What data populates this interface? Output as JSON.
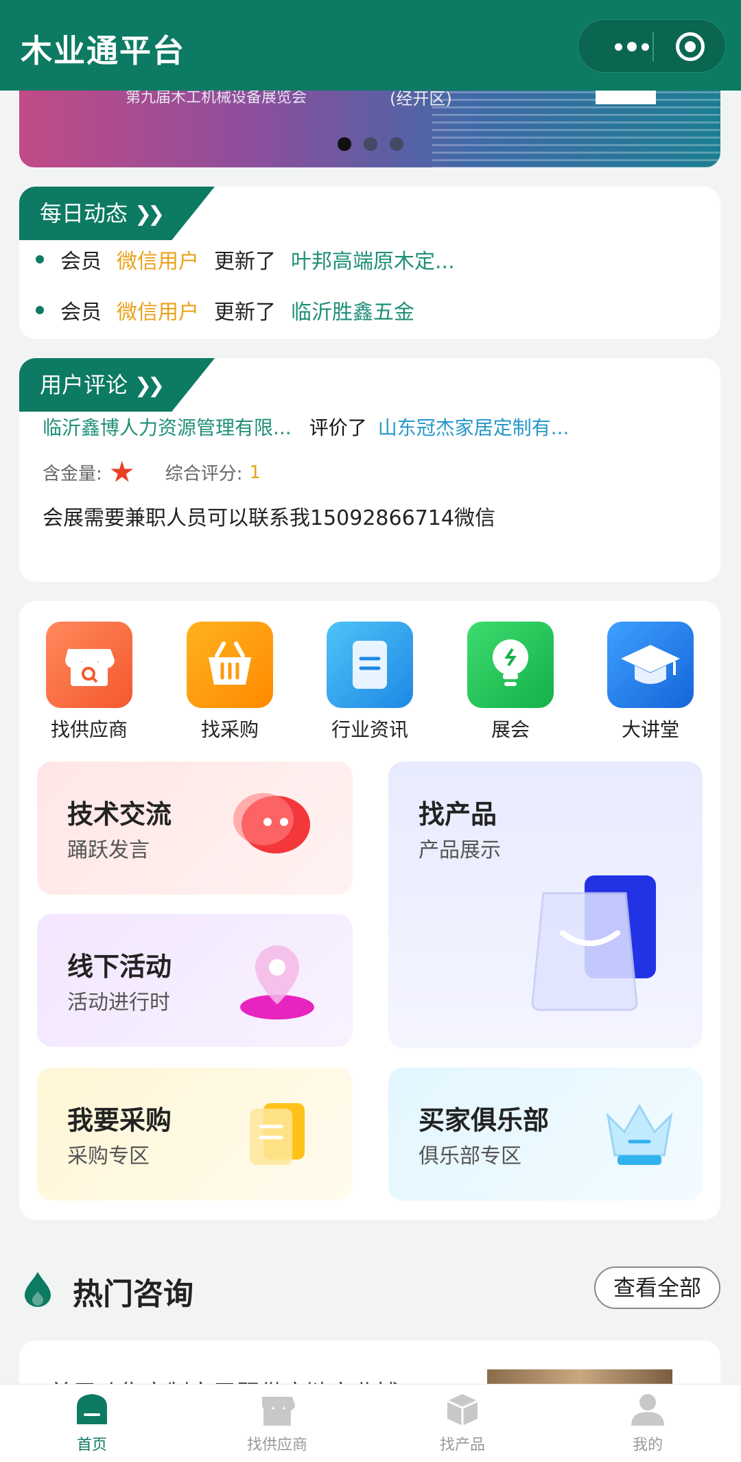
{
  "app": {
    "title": "木业通平台"
  },
  "banner": {
    "text_left": "第九届木工机械设备展览会",
    "text_right": "(经开区)"
  },
  "daily": {
    "tag": "每日动态",
    "items": [
      {
        "w1": "会员",
        "user": "微信用户",
        "w2": "更新了",
        "target": "叶邦高端原木定..."
      },
      {
        "w1": "会员",
        "user": "微信用户",
        "w2": "更新了",
        "target": "临沂胜鑫五金"
      }
    ]
  },
  "reviews": {
    "tag": "用户评论",
    "reviewer": "临沂鑫博人力资源管理有限...",
    "action": "评价了",
    "target": "山东冠杰家居定制有...",
    "gold_label": "含金量:",
    "score_label": "综合评分:",
    "score": "1",
    "content": "会展需要兼职人员可以联系我15092866714微信"
  },
  "quick": [
    {
      "label": "找供应商",
      "icon": "store-search-icon"
    },
    {
      "label": "找采购",
      "icon": "basket-icon"
    },
    {
      "label": "行业资讯",
      "icon": "document-icon"
    },
    {
      "label": "展会",
      "icon": "lightbulb-icon"
    },
    {
      "label": "大讲堂",
      "icon": "graduation-cap-icon"
    }
  ],
  "tiles": {
    "tech": {
      "title": "技术交流",
      "sub": "踊跃发言"
    },
    "product": {
      "title": "找产品",
      "sub": "产品展示"
    },
    "activity": {
      "title": "线下活动",
      "sub": "活动进行时"
    },
    "purchase": {
      "title": "我要采购",
      "sub": "采购专区"
    },
    "club": {
      "title": "买家俱乐部",
      "sub": "俱乐部专区"
    }
  },
  "hot": {
    "title": "热门咨询",
    "view_all": "查看全部",
    "first_item": "首届叶集定制家居暨供应链产业博"
  },
  "tabbar": [
    {
      "label": "首页",
      "icon": "home-icon",
      "active": true
    },
    {
      "label": "找供应商",
      "icon": "store-icon",
      "active": false
    },
    {
      "label": "找产品",
      "icon": "box-icon",
      "active": false
    },
    {
      "label": "我的",
      "icon": "user-icon",
      "active": false
    }
  ],
  "colors": {
    "primary": "#0d7a63",
    "highlight": "#e9a21b",
    "link": "#1f8f78",
    "link_blue": "#2597c9"
  }
}
